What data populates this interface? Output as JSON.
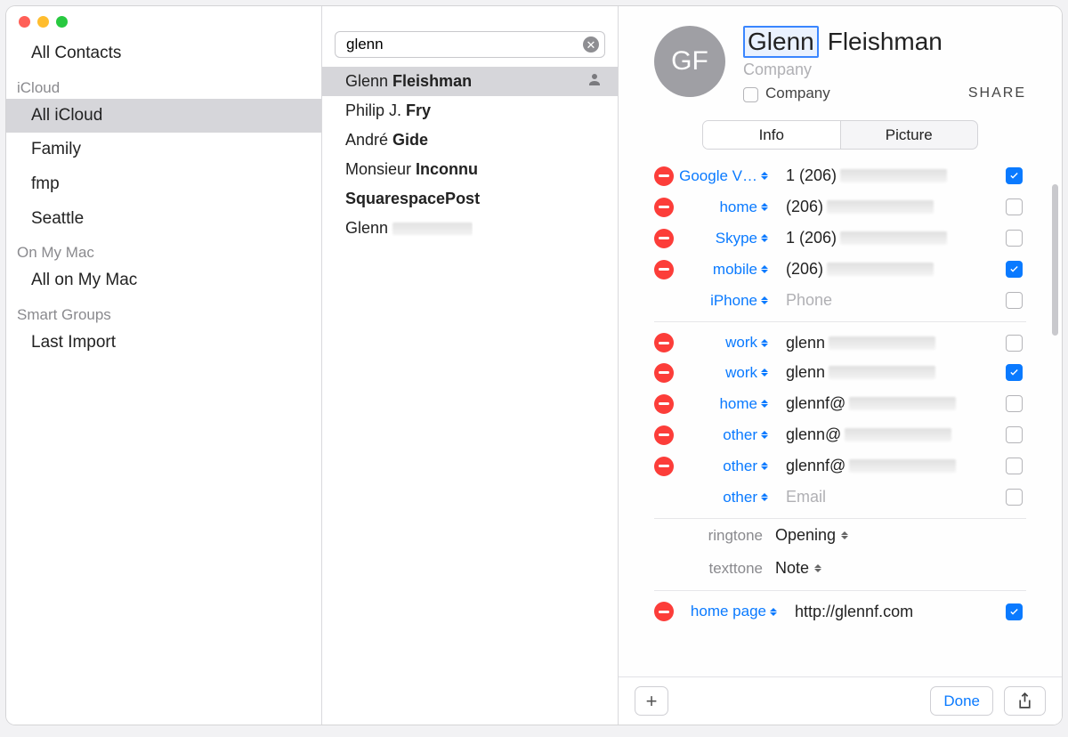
{
  "sidebar": {
    "top_item": "All Contacts",
    "groups": [
      {
        "header": "iCloud",
        "items": [
          {
            "label": "All iCloud",
            "selected": true
          },
          {
            "label": "Family"
          },
          {
            "label": "fmp"
          },
          {
            "label": "Seattle"
          }
        ]
      },
      {
        "header": "On My Mac",
        "items": [
          {
            "label": "All on My Mac"
          }
        ]
      },
      {
        "header": "Smart Groups",
        "items": [
          {
            "label": "Last Import"
          }
        ]
      }
    ]
  },
  "search": {
    "value": "glenn"
  },
  "results": [
    {
      "first": "Glenn",
      "last": "Fleishman",
      "selected": true,
      "user_icon": true
    },
    {
      "first": "Philip J.",
      "last": "Fry"
    },
    {
      "first": "André",
      "last": "Gide"
    },
    {
      "first": "Monsieur",
      "last": "Inconnu"
    },
    {
      "first": "",
      "last": "SquarespacePost"
    },
    {
      "first": "Glenn",
      "last": "",
      "blurred": true
    }
  ],
  "card": {
    "avatar_initials": "GF",
    "first": "Glenn",
    "last": "Fleishman",
    "company_placeholder": "Company",
    "company_label": "Company",
    "share": "SHARE",
    "tabs": {
      "info": "Info",
      "picture": "Picture",
      "active": "info"
    },
    "phones": [
      {
        "label": "Google V…",
        "value_prefix": "1 (206)",
        "blur": true,
        "checked": true,
        "remove": true,
        "trunc": true
      },
      {
        "label": "home",
        "value_prefix": "(206)",
        "blur": true,
        "checked": false,
        "remove": true
      },
      {
        "label": "Skype",
        "value_prefix": "1 (206)",
        "blur": true,
        "checked": false,
        "remove": true
      },
      {
        "label": "mobile",
        "value_prefix": "(206)",
        "blur": true,
        "checked": true,
        "remove": true
      },
      {
        "label": "iPhone",
        "placeholder": "Phone",
        "checked": false,
        "remove": false
      }
    ],
    "emails": [
      {
        "label": "work",
        "value_prefix": "glenn",
        "blur": true,
        "checked": false,
        "remove": true
      },
      {
        "label": "work",
        "value_prefix": "glenn",
        "blur": true,
        "checked": true,
        "remove": true
      },
      {
        "label": "home",
        "value_prefix": "glennf@",
        "blur": true,
        "checked": false,
        "remove": true
      },
      {
        "label": "other",
        "value_prefix": "glenn@",
        "blur": true,
        "checked": false,
        "remove": true
      },
      {
        "label": "other",
        "value_prefix": "glennf@",
        "blur": true,
        "checked": false,
        "remove": true
      },
      {
        "label": "other",
        "placeholder": "Email",
        "checked": false,
        "remove": false
      }
    ],
    "ringtone": {
      "label": "ringtone",
      "value": "Opening"
    },
    "texttone": {
      "label": "texttone",
      "value": "Note"
    },
    "homepage": {
      "label": "home page",
      "value": "http://glennf.com",
      "checked": true,
      "remove": true
    }
  },
  "toolbar": {
    "done": "Done"
  }
}
